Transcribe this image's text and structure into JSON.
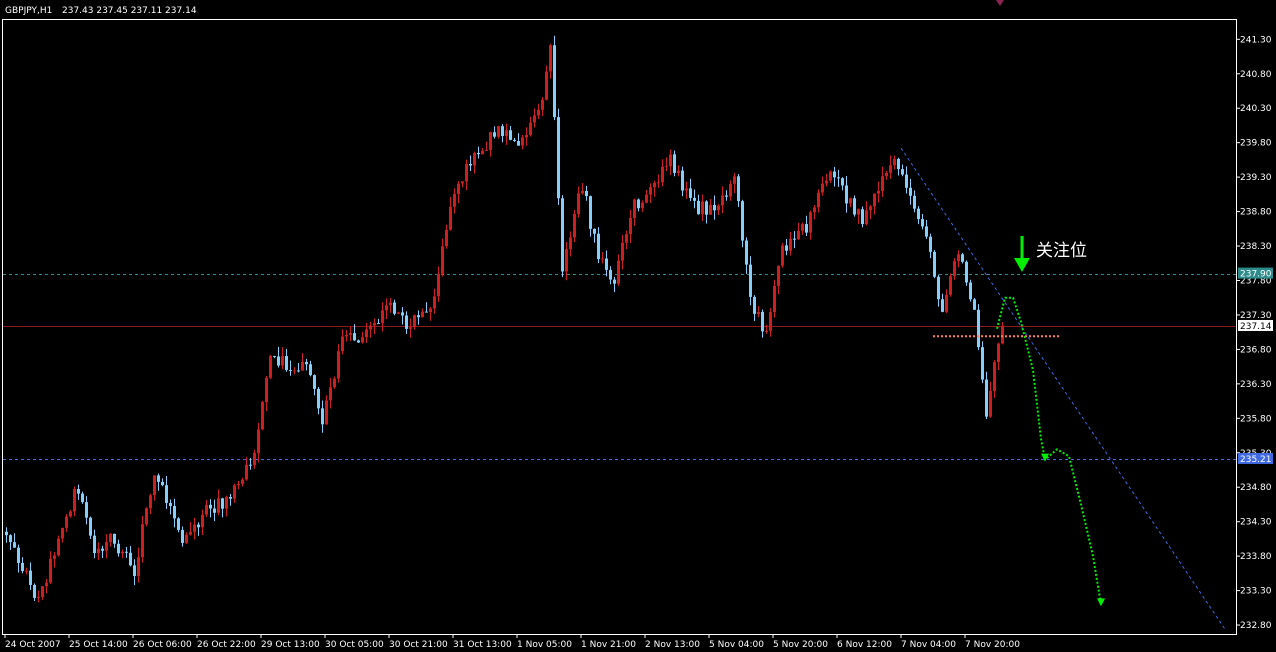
{
  "header": {
    "symbol": "GBPJPY,H1",
    "ohlc": "237.43 237.45 237.11 237.14"
  },
  "annotation": {
    "text": "关注位"
  },
  "colors": {
    "background": "#000000",
    "bull_candle": "#cc1f1f",
    "bear_candle": "#87cefa",
    "axis": "#ffffff",
    "resistance_line": "#2e8b8b",
    "support_line": "#4169e1",
    "price_line": "#8b1a1a",
    "trendline": "#4169e1",
    "forecast": "#00ee00",
    "marker_line": "#ff7f50"
  },
  "chart_data": {
    "type": "candlestick",
    "title": "GBPJPY,H1",
    "ylim": [
      232.67,
      241.58
    ],
    "y_ticks": [
      "241.30",
      "240.80",
      "240.30",
      "239.80",
      "239.30",
      "238.80",
      "238.30",
      "237.80",
      "237.30",
      "236.80",
      "236.30",
      "235.80",
      "235.30",
      "234.80",
      "234.30",
      "233.80",
      "233.30",
      "232.80"
    ],
    "x_ticks": [
      "24 Oct 2007",
      "25 Oct 14:00",
      "26 Oct 06:00",
      "26 Oct 22:00",
      "29 Oct 13:00",
      "30 Oct 05:00",
      "30 Oct 21:00",
      "31 Oct 13:00",
      "1 Nov 05:00",
      "1 Nov 21:00",
      "2 Nov 13:00",
      "5 Nov 04:00",
      "5 Nov 20:00",
      "6 Nov 12:00",
      "7 Nov 04:00",
      "7 Nov 20:00"
    ],
    "horizontal_levels": [
      {
        "value": 237.9,
        "label": "237.90",
        "style": "dashed",
        "color": "#2e8b8b"
      },
      {
        "value": 237.14,
        "label": "237.14",
        "style": "solid",
        "color": "#8b1a1a"
      },
      {
        "value": 235.21,
        "label": "235.21",
        "style": "dashed",
        "color": "#4169e1"
      }
    ],
    "trendline": {
      "from": {
        "bar": 224,
        "price": 239.72
      },
      "to": {
        "bar": 305,
        "price": 232.74
      }
    },
    "marker_line": {
      "from_bar": 232,
      "to_bar": 264,
      "price": 236.99
    },
    "forecast_path": [
      {
        "bar": 248,
        "price": 237.1
      },
      {
        "bar": 250,
        "price": 237.55
      },
      {
        "bar": 252,
        "price": 237.55
      },
      {
        "bar": 254,
        "price": 237.2
      },
      {
        "bar": 257,
        "price": 236.5
      },
      {
        "bar": 259,
        "price": 235.5
      },
      {
        "bar": 260,
        "price": 235.2
      },
      {
        "bar": 263,
        "price": 235.35
      },
      {
        "bar": 266,
        "price": 235.25
      },
      {
        "bar": 269,
        "price": 234.55
      },
      {
        "bar": 272,
        "price": 233.8
      },
      {
        "bar": 274,
        "price": 233.1
      }
    ],
    "price_path": [
      [
        0,
        234.15
      ],
      [
        8,
        233.1
      ],
      [
        14,
        234.3
      ],
      [
        18,
        234.8
      ],
      [
        22,
        233.75
      ],
      [
        26,
        234.05
      ],
      [
        32,
        233.6
      ],
      [
        37,
        235.05
      ],
      [
        44,
        233.95
      ],
      [
        50,
        234.5
      ],
      [
        56,
        234.6
      ],
      [
        62,
        235.35
      ],
      [
        66,
        236.8
      ],
      [
        70,
        236.55
      ],
      [
        75,
        236.55
      ],
      [
        79,
        235.75
      ],
      [
        84,
        236.95
      ],
      [
        88,
        237.0
      ],
      [
        92,
        237.2
      ],
      [
        96,
        237.45
      ],
      [
        100,
        237.15
      ],
      [
        106,
        237.35
      ],
      [
        112,
        239.1
      ],
      [
        118,
        239.7
      ],
      [
        124,
        240.0
      ],
      [
        128,
        239.7
      ],
      [
        134,
        240.5
      ],
      [
        136,
        241.25
      ],
      [
        139,
        238.0
      ],
      [
        144,
        239.2
      ],
      [
        148,
        238.1
      ],
      [
        152,
        237.8
      ],
      [
        156,
        238.8
      ],
      [
        162,
        239.2
      ],
      [
        166,
        239.55
      ],
      [
        172,
        238.85
      ],
      [
        178,
        238.85
      ],
      [
        182,
        239.35
      ],
      [
        186,
        237.5
      ],
      [
        190,
        237.0
      ],
      [
        194,
        238.25
      ],
      [
        200,
        238.6
      ],
      [
        206,
        239.35
      ],
      [
        210,
        239.0
      ],
      [
        214,
        238.65
      ],
      [
        218,
        239.2
      ],
      [
        222,
        239.55
      ],
      [
        226,
        239.0
      ],
      [
        230,
        238.45
      ],
      [
        234,
        237.35
      ],
      [
        238,
        238.2
      ],
      [
        242,
        237.4
      ],
      [
        245,
        235.85
      ],
      [
        248,
        236.95
      ],
      [
        249,
        237.14
      ]
    ],
    "price_seed": 20071024
  }
}
